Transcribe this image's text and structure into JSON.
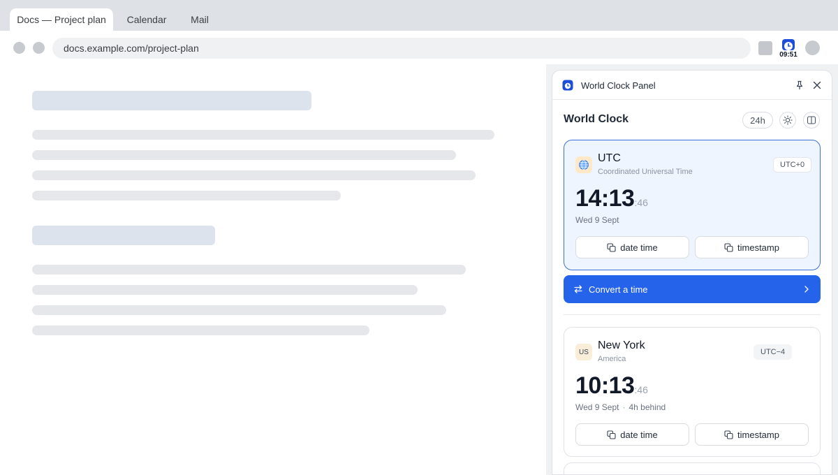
{
  "browser": {
    "tabs": [
      {
        "label": "Docs — Project plan",
        "active": true
      },
      {
        "label": "Calendar",
        "active": false
      },
      {
        "label": "Mail",
        "active": false
      }
    ],
    "url": "docs.example.com/project-plan",
    "extension_badge_time": "09:51"
  },
  "panel": {
    "title": "World Clock Panel",
    "section_title": "World Clock",
    "format_toggle": "24h",
    "accent_color": "#2563eb",
    "clocks": [
      {
        "flag": "globe-icon",
        "name": "UTC",
        "subtitle": "Coordinated Universal Time",
        "offset": "UTC+0",
        "time": "14:13",
        "seconds": ":46",
        "date": "Wed 9 Sept",
        "relative": "",
        "copy_datetime": "date time",
        "copy_timestamp": "timestamp"
      },
      {
        "flag": "US",
        "name": "New York",
        "subtitle": "America",
        "offset": "UTC−4",
        "time": "10:13",
        "seconds": ":46",
        "date": "Wed 9 Sept",
        "relative": "4h behind",
        "copy_datetime": "date time",
        "copy_timestamp": "timestamp"
      }
    ],
    "convert_label": "Convert a time"
  }
}
